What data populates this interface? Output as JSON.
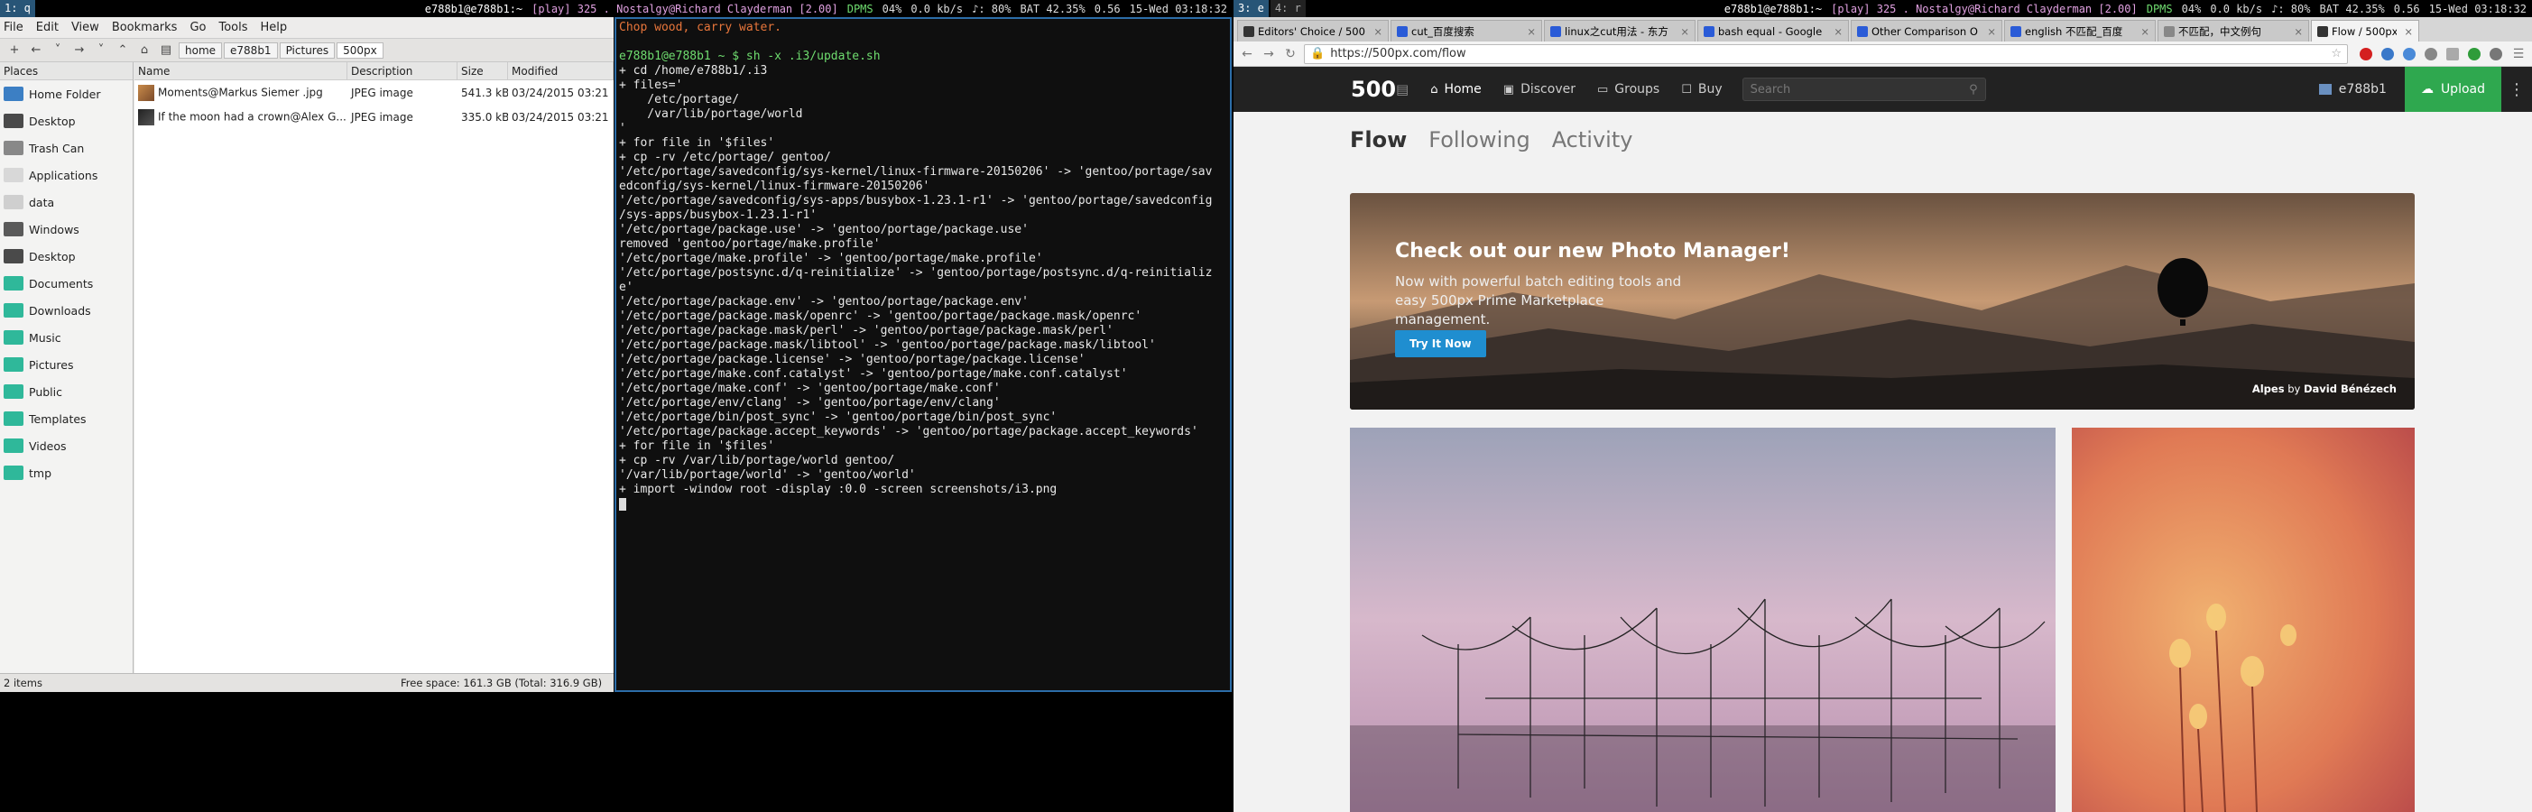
{
  "left_bar": {
    "workspace": "1: q",
    "window_title": "e788b1@e788b1:~",
    "now_playing": "[play] 325 . Nostalgy@Richard Clayderman [2.00]",
    "dpms": "DPMS",
    "cpu": "04%",
    "net": "0.0 kb/s",
    "volume": "♪: 80%",
    "battery": "BAT 42.35%",
    "load": "0.56",
    "datetime": "15-Wed 03:18:32"
  },
  "right_bar": {
    "workspace_3": "3: e",
    "workspace_4": "4: r",
    "window_title": "e788b1@e788b1:~",
    "now_playing": "[play] 325 . Nostalgy@Richard Clayderman [2.00]",
    "dpms": "DPMS",
    "cpu": "04%",
    "net": "0.0 kb/s",
    "volume": "♪: 80%",
    "battery": "BAT 42.35%",
    "load": "0.56",
    "datetime": "15-Wed 03:18:32"
  },
  "file_manager": {
    "menu": [
      "File",
      "Edit",
      "View",
      "Bookmarks",
      "Go",
      "Tools",
      "Help"
    ],
    "breadcrumb": [
      "home",
      "e788b1",
      "Pictures",
      "500px"
    ],
    "places_header": "Places",
    "places": [
      {
        "label": "Home Folder",
        "color": "#3c7fc4"
      },
      {
        "label": "Desktop",
        "color": "#4a4a4a"
      },
      {
        "label": "Trash Can",
        "color": "#888888"
      },
      {
        "label": "Applications",
        "color": "#d8d8d8"
      },
      {
        "label": "data",
        "color": "#cfcfcf"
      },
      {
        "label": "Windows",
        "color": "#5a5a5a"
      },
      {
        "label": "Desktop",
        "color": "#4a4a4a"
      },
      {
        "label": "Documents",
        "color": "#2fb89a"
      },
      {
        "label": "Downloads",
        "color": "#2fb89a"
      },
      {
        "label": "Music",
        "color": "#2fb89a"
      },
      {
        "label": "Pictures",
        "color": "#2fb89a"
      },
      {
        "label": "Public",
        "color": "#2fb89a"
      },
      {
        "label": "Templates",
        "color": "#2fb89a"
      },
      {
        "label": "Videos",
        "color": "#2fb89a"
      },
      {
        "label": "tmp",
        "color": "#2fb89a"
      }
    ],
    "columns": [
      "Name",
      "Description",
      "Size",
      "Modified"
    ],
    "rows": [
      {
        "name": "Moments@Markus Siemer .jpg",
        "description": "JPEG image",
        "size": "541.3 kB",
        "modified": "03/24/2015 03:21"
      },
      {
        "name": "If the moon had a crown@Alex G...",
        "description": "JPEG image",
        "size": "335.0 kB",
        "modified": "03/24/2015 03:21"
      }
    ],
    "status_items": "2 items",
    "status_free": "Free space: 161.3 GB (Total: 316.9 GB)"
  },
  "terminal": {
    "lines": [
      {
        "text": "Chop wood, carry water.",
        "style": "orange"
      },
      {
        "text": "",
        "style": ""
      },
      {
        "text": "e788b1@e788b1 ~ $ sh -x .i3/update.sh",
        "style": "green"
      },
      {
        "text": "+ cd /home/e788b1/.i3",
        "style": ""
      },
      {
        "text": "+ files='",
        "style": ""
      },
      {
        "text": "    /etc/portage/",
        "style": ""
      },
      {
        "text": "    /var/lib/portage/world",
        "style": ""
      },
      {
        "text": "'",
        "style": ""
      },
      {
        "text": "+ for file in '$files'",
        "style": ""
      },
      {
        "text": "+ cp -rv /etc/portage/ gentoo/",
        "style": ""
      },
      {
        "text": "'/etc/portage/savedconfig/sys-kernel/linux-firmware-20150206' -> 'gentoo/portage/sav",
        "style": ""
      },
      {
        "text": "edconfig/sys-kernel/linux-firmware-20150206'",
        "style": ""
      },
      {
        "text": "'/etc/portage/savedconfig/sys-apps/busybox-1.23.1-r1' -> 'gentoo/portage/savedconfig",
        "style": ""
      },
      {
        "text": "/sys-apps/busybox-1.23.1-r1'",
        "style": ""
      },
      {
        "text": "'/etc/portage/package.use' -> 'gentoo/portage/package.use'",
        "style": ""
      },
      {
        "text": "removed 'gentoo/portage/make.profile'",
        "style": ""
      },
      {
        "text": "'/etc/portage/make.profile' -> 'gentoo/portage/make.profile'",
        "style": ""
      },
      {
        "text": "'/etc/portage/postsync.d/q-reinitialize' -> 'gentoo/portage/postsync.d/q-reinitializ",
        "style": ""
      },
      {
        "text": "e'",
        "style": ""
      },
      {
        "text": "'/etc/portage/package.env' -> 'gentoo/portage/package.env'",
        "style": ""
      },
      {
        "text": "'/etc/portage/package.mask/openrc' -> 'gentoo/portage/package.mask/openrc'",
        "style": ""
      },
      {
        "text": "'/etc/portage/package.mask/perl' -> 'gentoo/portage/package.mask/perl'",
        "style": ""
      },
      {
        "text": "'/etc/portage/package.mask/libtool' -> 'gentoo/portage/package.mask/libtool'",
        "style": ""
      },
      {
        "text": "'/etc/portage/package.license' -> 'gentoo/portage/package.license'",
        "style": ""
      },
      {
        "text": "'/etc/portage/make.conf.catalyst' -> 'gentoo/portage/make.conf.catalyst'",
        "style": ""
      },
      {
        "text": "'/etc/portage/make.conf' -> 'gentoo/portage/make.conf'",
        "style": ""
      },
      {
        "text": "'/etc/portage/env/clang' -> 'gentoo/portage/env/clang'",
        "style": ""
      },
      {
        "text": "'/etc/portage/bin/post_sync' -> 'gentoo/portage/bin/post_sync'",
        "style": ""
      },
      {
        "text": "'/etc/portage/package.accept_keywords' -> 'gentoo/portage/package.accept_keywords'",
        "style": ""
      },
      {
        "text": "+ for file in '$files'",
        "style": ""
      },
      {
        "text": "+ cp -rv /var/lib/portage/world gentoo/",
        "style": ""
      },
      {
        "text": "'/var/lib/portage/world' -> 'gentoo/world'",
        "style": ""
      },
      {
        "text": "+ import -window root -display :0.0 -screen screenshots/i3.png",
        "style": ""
      }
    ]
  },
  "browser": {
    "tabs": [
      {
        "label": "Editors' Choice / 500",
        "color": "#333333"
      },
      {
        "label": "cut_百度搜索",
        "color": "#2a5bd7"
      },
      {
        "label": "linux之cut用法 - 东方",
        "color": "#2a5bd7"
      },
      {
        "label": "bash equal - Google",
        "color": "#2a5bd7"
      },
      {
        "label": "Other Comparison O",
        "color": "#2a5bd7"
      },
      {
        "label": "english 不匹配_百度",
        "color": "#2a5bd7"
      },
      {
        "label": "不匹配，中文例句",
        "color": "#888888"
      },
      {
        "label": "Flow / 500px",
        "color": "#333333"
      }
    ],
    "active_tab": 7,
    "url": "https://500px.com/flow",
    "site": {
      "logo": "500",
      "nav": [
        "Home",
        "Discover",
        "Groups",
        "Buy"
      ],
      "search_placeholder": "Search",
      "user": "e788b1",
      "upload": "Upload",
      "flow_tabs": [
        "Flow",
        "Following",
        "Activity"
      ],
      "hero_title": "Check out our new Photo Manager!",
      "hero_text": "Now with powerful batch editing tools and easy 500px Prime Marketplace management.",
      "hero_button": "Try It Now",
      "hero_caption_title": "Alpes",
      "hero_caption_by": "by",
      "hero_caption_author": "David Bénézech"
    }
  }
}
